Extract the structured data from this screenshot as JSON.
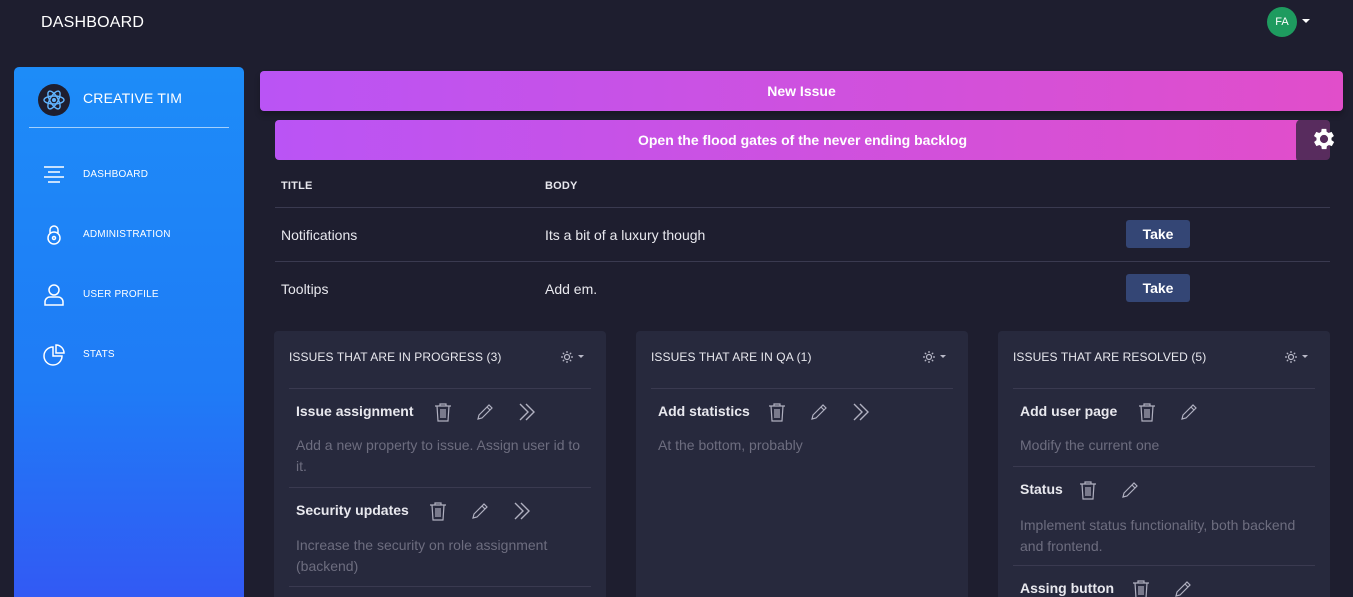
{
  "header": {
    "title": "DASHBOARD",
    "user_initials": "FA"
  },
  "sidebar": {
    "brand": "CREATIVE TIM",
    "items": [
      {
        "label": "DASHBOARD",
        "icon": "align-center-icon"
      },
      {
        "label": "ADMINISTRATION",
        "icon": "lock-icon"
      },
      {
        "label": "USER PROFILE",
        "icon": "user-icon"
      },
      {
        "label": "STATS",
        "icon": "pie-chart-icon"
      }
    ]
  },
  "actions": {
    "new_issue": "New Issue",
    "backlog": "Open the flood gates of the never ending backlog"
  },
  "backlog_table": {
    "columns": [
      "TITLE",
      "BODY"
    ],
    "rows": [
      {
        "title": "Notifications",
        "body": "Its a bit of a luxury though",
        "action": "Take"
      },
      {
        "title": "Tooltips",
        "body": "Add em.",
        "action": "Take"
      }
    ]
  },
  "columns": [
    {
      "title": "ISSUES THAT ARE IN PROGRESS (3)",
      "issues": [
        {
          "title": "Issue assignment",
          "desc": "Add a new property to issue. Assign user id to it."
        },
        {
          "title": "Security updates",
          "desc": "Increase the security on role assignment (backend)"
        }
      ]
    },
    {
      "title": "ISSUES THAT ARE IN QA (1)",
      "issues": [
        {
          "title": "Add statistics",
          "desc": "At the bottom, probably"
        }
      ]
    },
    {
      "title": "ISSUES THAT ARE RESOLVED (5)",
      "issues": [
        {
          "title": "Add user page",
          "desc": "Modify the current one"
        },
        {
          "title": "Status",
          "desc": "Implement status functionality, both backend and frontend."
        },
        {
          "title": "Assing button",
          "desc": ""
        }
      ]
    }
  ],
  "colors": {
    "background": "#1e1e2f",
    "card": "#27293d",
    "sidebar_start": "#1d8cf8",
    "sidebar_end": "#3358f4",
    "primary_start": "#ba54f5",
    "primary_end": "#e14eca",
    "take_button": "#344675"
  }
}
